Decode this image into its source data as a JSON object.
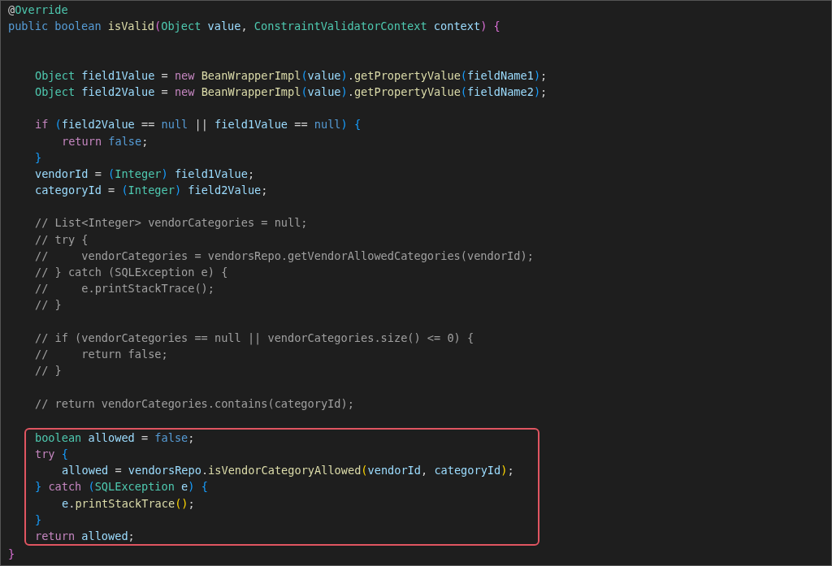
{
  "editor": {
    "lines": [
      {
        "kind": "code",
        "tokens": [
          {
            "kind": "plain",
            "text": "@"
          },
          {
            "kind": "type",
            "text": "Override"
          }
        ]
      },
      {
        "kind": "code",
        "tokens": [
          {
            "kind": "kw",
            "text": "public boolean "
          },
          {
            "kind": "fn",
            "text": "isValid"
          },
          {
            "kind": "b2",
            "text": "("
          },
          {
            "kind": "type",
            "text": "Object "
          },
          {
            "kind": "var",
            "text": "value"
          },
          {
            "kind": "plain",
            "text": ", "
          },
          {
            "kind": "type",
            "text": "ConstraintValidatorContext "
          },
          {
            "kind": "var",
            "text": "context"
          },
          {
            "kind": "b2",
            "text": ") {"
          }
        ],
        "children": [
          {
            "kind": "blank"
          },
          {
            "kind": "blank"
          },
          {
            "kind": "code",
            "tokens": [
              {
                "kind": "type",
                "text": "Object "
              },
              {
                "kind": "var",
                "text": "field1Value"
              },
              {
                "kind": "plain",
                "text": " = "
              },
              {
                "kind": "ctrl",
                "text": "new "
              },
              {
                "kind": "fn",
                "text": "BeanWrapperImpl"
              },
              {
                "kind": "b3",
                "text": "("
              },
              {
                "kind": "var",
                "text": "value"
              },
              {
                "kind": "b3",
                "text": ")"
              },
              {
                "kind": "plain",
                "text": "."
              },
              {
                "kind": "fn",
                "text": "getPropertyValue"
              },
              {
                "kind": "b3",
                "text": "("
              },
              {
                "kind": "var",
                "text": "fieldName1"
              },
              {
                "kind": "b3",
                "text": ")"
              },
              {
                "kind": "plain",
                "text": ";"
              }
            ]
          },
          {
            "kind": "code",
            "tokens": [
              {
                "kind": "type",
                "text": "Object "
              },
              {
                "kind": "var",
                "text": "field2Value"
              },
              {
                "kind": "plain",
                "text": " = "
              },
              {
                "kind": "ctrl",
                "text": "new "
              },
              {
                "kind": "fn",
                "text": "BeanWrapperImpl"
              },
              {
                "kind": "b3",
                "text": "("
              },
              {
                "kind": "var",
                "text": "value"
              },
              {
                "kind": "b3",
                "text": ")"
              },
              {
                "kind": "plain",
                "text": "."
              },
              {
                "kind": "fn",
                "text": "getPropertyValue"
              },
              {
                "kind": "b3",
                "text": "("
              },
              {
                "kind": "var",
                "text": "fieldName2"
              },
              {
                "kind": "b3",
                "text": ")"
              },
              {
                "kind": "plain",
                "text": ";"
              }
            ]
          },
          {
            "kind": "blank"
          },
          {
            "kind": "code",
            "tokens": [
              {
                "kind": "ctrl",
                "text": "if "
              },
              {
                "kind": "b3",
                "text": "("
              },
              {
                "kind": "var",
                "text": "field2Value"
              },
              {
                "kind": "plain",
                "text": " == "
              },
              {
                "kind": "kw",
                "text": "null"
              },
              {
                "kind": "plain",
                "text": " || "
              },
              {
                "kind": "var",
                "text": "field1Value"
              },
              {
                "kind": "plain",
                "text": " == "
              },
              {
                "kind": "kw",
                "text": "null"
              },
              {
                "kind": "b3",
                "text": ") {"
              }
            ],
            "children": [
              {
                "kind": "code",
                "tokens": [
                  {
                    "kind": "ctrl",
                    "text": "return "
                  },
                  {
                    "kind": "kw",
                    "text": "false"
                  },
                  {
                    "kind": "plain",
                    "text": ";"
                  }
                ]
              }
            ]
          },
          {
            "kind": "code",
            "tokens": [
              {
                "kind": "b3",
                "text": "}"
              }
            ]
          },
          {
            "kind": "code",
            "tokens": [
              {
                "kind": "var",
                "text": "vendorId"
              },
              {
                "kind": "plain",
                "text": " = "
              },
              {
                "kind": "b3",
                "text": "("
              },
              {
                "kind": "type",
                "text": "Integer"
              },
              {
                "kind": "b3",
                "text": ") "
              },
              {
                "kind": "var",
                "text": "field1Value"
              },
              {
                "kind": "plain",
                "text": ";"
              }
            ]
          },
          {
            "kind": "code",
            "tokens": [
              {
                "kind": "var",
                "text": "categoryId"
              },
              {
                "kind": "plain",
                "text": " = "
              },
              {
                "kind": "b3",
                "text": "("
              },
              {
                "kind": "type",
                "text": "Integer"
              },
              {
                "kind": "b3",
                "text": ") "
              },
              {
                "kind": "var",
                "text": "field2Value"
              },
              {
                "kind": "plain",
                "text": ";"
              }
            ]
          },
          {
            "kind": "blank"
          },
          {
            "kind": "code",
            "tokens": [
              {
                "kind": "com",
                "text": "// List<Integer> vendorCategories = null;"
              }
            ]
          },
          {
            "kind": "code",
            "tokens": [
              {
                "kind": "com",
                "text": "// try {"
              }
            ]
          },
          {
            "kind": "code",
            "tokens": [
              {
                "kind": "com",
                "text": "//     vendorCategories = vendorsRepo.getVendorAllowedCategories(vendorId);"
              }
            ]
          },
          {
            "kind": "code",
            "tokens": [
              {
                "kind": "com",
                "text": "// } catch (SQLException e) {"
              }
            ]
          },
          {
            "kind": "code",
            "tokens": [
              {
                "kind": "com",
                "text": "//     e.printStackTrace();"
              }
            ]
          },
          {
            "kind": "code",
            "tokens": [
              {
                "kind": "com",
                "text": "// }"
              }
            ]
          },
          {
            "kind": "blank"
          },
          {
            "kind": "code",
            "tokens": [
              {
                "kind": "com",
                "text": "// if (vendorCategories == null || vendorCategories.size() <= 0) {"
              }
            ]
          },
          {
            "kind": "code",
            "tokens": [
              {
                "kind": "com",
                "text": "//     return false;"
              }
            ]
          },
          {
            "kind": "code",
            "tokens": [
              {
                "kind": "com",
                "text": "// }"
              }
            ]
          },
          {
            "kind": "blank"
          },
          {
            "kind": "code",
            "tokens": [
              {
                "kind": "com",
                "text": "// return vendorCategories.contains(categoryId);"
              }
            ]
          },
          {
            "kind": "blank"
          },
          {
            "kind": "group",
            "highlighted": true,
            "children": [
              {
                "kind": "code",
                "tokens": [
                  {
                    "kind": "type",
                    "text": "boolean "
                  },
                  {
                    "kind": "var",
                    "text": "allowed"
                  },
                  {
                    "kind": "plain",
                    "text": " = "
                  },
                  {
                    "kind": "kw",
                    "text": "false"
                  },
                  {
                    "kind": "plain",
                    "text": ";"
                  }
                ]
              },
              {
                "kind": "code",
                "tokens": [
                  {
                    "kind": "ctrl",
                    "text": "try "
                  },
                  {
                    "kind": "b3",
                    "text": "{"
                  }
                ],
                "children": [
                  {
                    "kind": "code",
                    "tokens": [
                      {
                        "kind": "var",
                        "text": "allowed"
                      },
                      {
                        "kind": "plain",
                        "text": " = "
                      },
                      {
                        "kind": "var",
                        "text": "vendorsRepo"
                      },
                      {
                        "kind": "plain",
                        "text": "."
                      },
                      {
                        "kind": "fn",
                        "text": "isVendorCategoryAllowed"
                      },
                      {
                        "kind": "b1",
                        "text": "("
                      },
                      {
                        "kind": "var",
                        "text": "vendorId"
                      },
                      {
                        "kind": "plain",
                        "text": ", "
                      },
                      {
                        "kind": "var",
                        "text": "categoryId"
                      },
                      {
                        "kind": "b1",
                        "text": ")"
                      },
                      {
                        "kind": "plain",
                        "text": ";"
                      }
                    ]
                  }
                ]
              },
              {
                "kind": "code",
                "tokens": [
                  {
                    "kind": "b3",
                    "text": "} "
                  },
                  {
                    "kind": "ctrl",
                    "text": "catch "
                  },
                  {
                    "kind": "b3",
                    "text": "("
                  },
                  {
                    "kind": "type",
                    "text": "SQLException "
                  },
                  {
                    "kind": "var",
                    "text": "e"
                  },
                  {
                    "kind": "b3",
                    "text": ") {"
                  }
                ],
                "children": [
                  {
                    "kind": "code",
                    "tokens": [
                      {
                        "kind": "var",
                        "text": "e"
                      },
                      {
                        "kind": "plain",
                        "text": "."
                      },
                      {
                        "kind": "fn",
                        "text": "printStackTrace"
                      },
                      {
                        "kind": "b1",
                        "text": "()"
                      },
                      {
                        "kind": "plain",
                        "text": ";"
                      }
                    ]
                  }
                ]
              },
              {
                "kind": "code",
                "tokens": [
                  {
                    "kind": "b3",
                    "text": "}"
                  }
                ]
              },
              {
                "kind": "code",
                "tokens": [
                  {
                    "kind": "ctrl",
                    "text": "return "
                  },
                  {
                    "kind": "var",
                    "text": "allowed"
                  },
                  {
                    "kind": "plain",
                    "text": ";"
                  }
                ]
              }
            ]
          }
        ]
      },
      {
        "kind": "code",
        "tokens": [
          {
            "kind": "b2",
            "text": "}"
          }
        ]
      }
    ]
  }
}
